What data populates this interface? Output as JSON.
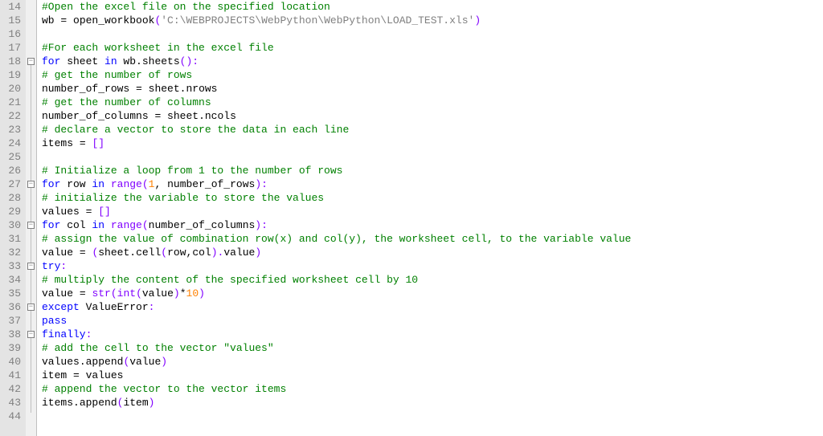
{
  "editor": {
    "first_line": 14,
    "last_line": 44,
    "fold_marks": [
      18,
      27,
      30,
      33,
      36,
      38
    ],
    "lines": [
      {
        "n": 14,
        "indent": 0,
        "tokens": [
          {
            "t": "#Open the excel file on the specified location",
            "c": "c-comment"
          }
        ]
      },
      {
        "n": 15,
        "indent": 0,
        "tokens": [
          {
            "t": "wb ",
            "c": "c-ident"
          },
          {
            "t": "=",
            "c": "c-op"
          },
          {
            "t": " open_workbook",
            "c": "c-ident"
          },
          {
            "t": "(",
            "c": "c-paren"
          },
          {
            "t": "'C:\\WEBPROJECTS\\WebPython\\WebPython\\LOAD_TEST.xls'",
            "c": "c-string"
          },
          {
            "t": ")",
            "c": "c-paren"
          }
        ]
      },
      {
        "n": 16,
        "indent": 0,
        "tokens": []
      },
      {
        "n": 17,
        "indent": 0,
        "tokens": [
          {
            "t": "#For each worksheet in the excel file",
            "c": "c-comment"
          }
        ]
      },
      {
        "n": 18,
        "indent": 0,
        "tokens": [
          {
            "t": "for",
            "c": "c-keyword"
          },
          {
            "t": " sheet ",
            "c": "c-ident"
          },
          {
            "t": "in",
            "c": "c-keyword"
          },
          {
            "t": " wb",
            "c": "c-ident"
          },
          {
            "t": ".",
            "c": "c-op"
          },
          {
            "t": "sheets",
            "c": "c-ident"
          },
          {
            "t": "():",
            "c": "c-paren"
          }
        ]
      },
      {
        "n": 19,
        "indent": 1,
        "tokens": [
          {
            "t": "# get the number of rows",
            "c": "c-comment"
          }
        ]
      },
      {
        "n": 20,
        "indent": 1,
        "tokens": [
          {
            "t": "number_of_rows ",
            "c": "c-ident"
          },
          {
            "t": "=",
            "c": "c-op"
          },
          {
            "t": " sheet",
            "c": "c-ident"
          },
          {
            "t": ".",
            "c": "c-op"
          },
          {
            "t": "nrows",
            "c": "c-ident"
          }
        ]
      },
      {
        "n": 21,
        "indent": 1,
        "tokens": [
          {
            "t": "# get the number of columns",
            "c": "c-comment"
          }
        ]
      },
      {
        "n": 22,
        "indent": 1,
        "tokens": [
          {
            "t": "number_of_columns ",
            "c": "c-ident"
          },
          {
            "t": "=",
            "c": "c-op"
          },
          {
            "t": " sheet",
            "c": "c-ident"
          },
          {
            "t": ".",
            "c": "c-op"
          },
          {
            "t": "ncols",
            "c": "c-ident"
          }
        ]
      },
      {
        "n": 23,
        "indent": 1,
        "tokens": [
          {
            "t": "# declare a vector to store the data in each line",
            "c": "c-comment"
          }
        ]
      },
      {
        "n": 24,
        "indent": 1,
        "tokens": [
          {
            "t": "items ",
            "c": "c-ident"
          },
          {
            "t": "=",
            "c": "c-op"
          },
          {
            "t": " ",
            "c": "c-ident"
          },
          {
            "t": "[]",
            "c": "c-paren"
          }
        ]
      },
      {
        "n": 25,
        "indent": 0,
        "tokens": []
      },
      {
        "n": 26,
        "indent": 1,
        "tokens": [
          {
            "t": "# Initialize a loop from 1 to the number of rows",
            "c": "c-comment"
          }
        ]
      },
      {
        "n": 27,
        "indent": 1,
        "tokens": [
          {
            "t": "for",
            "c": "c-keyword"
          },
          {
            "t": " row ",
            "c": "c-ident"
          },
          {
            "t": "in",
            "c": "c-keyword"
          },
          {
            "t": " ",
            "c": "c-ident"
          },
          {
            "t": "range",
            "c": "c-builtin"
          },
          {
            "t": "(",
            "c": "c-paren"
          },
          {
            "t": "1",
            "c": "c-num"
          },
          {
            "t": ",",
            "c": "c-op"
          },
          {
            "t": " number_of_rows",
            "c": "c-ident"
          },
          {
            "t": "):",
            "c": "c-paren"
          }
        ]
      },
      {
        "n": 28,
        "indent": 2,
        "tokens": [
          {
            "t": "# initialize the variable to store the values",
            "c": "c-comment"
          }
        ]
      },
      {
        "n": 29,
        "indent": 2,
        "tokens": [
          {
            "t": "values ",
            "c": "c-ident"
          },
          {
            "t": "=",
            "c": "c-op"
          },
          {
            "t": " ",
            "c": "c-ident"
          },
          {
            "t": "[]",
            "c": "c-paren"
          }
        ]
      },
      {
        "n": 30,
        "indent": 2,
        "tokens": [
          {
            "t": "for",
            "c": "c-keyword"
          },
          {
            "t": " col ",
            "c": "c-ident"
          },
          {
            "t": "in",
            "c": "c-keyword"
          },
          {
            "t": " ",
            "c": "c-ident"
          },
          {
            "t": "range",
            "c": "c-builtin"
          },
          {
            "t": "(",
            "c": "c-paren"
          },
          {
            "t": "number_of_columns",
            "c": "c-ident"
          },
          {
            "t": "):",
            "c": "c-paren"
          }
        ]
      },
      {
        "n": 31,
        "indent": 3,
        "tokens": [
          {
            "t": "# assign the value of combination row(x) and col(y), the worksheet cell, to the variable value",
            "c": "c-comment"
          }
        ]
      },
      {
        "n": 32,
        "indent": 3,
        "tokens": [
          {
            "t": "value  ",
            "c": "c-ident"
          },
          {
            "t": "=",
            "c": "c-op"
          },
          {
            "t": " ",
            "c": "c-ident"
          },
          {
            "t": "(",
            "c": "c-paren"
          },
          {
            "t": "sheet",
            "c": "c-ident"
          },
          {
            "t": ".",
            "c": "c-op"
          },
          {
            "t": "cell",
            "c": "c-ident"
          },
          {
            "t": "(",
            "c": "c-paren"
          },
          {
            "t": "row",
            "c": "c-ident"
          },
          {
            "t": ",",
            "c": "c-op"
          },
          {
            "t": "col",
            "c": "c-ident"
          },
          {
            "t": ").",
            "c": "c-paren"
          },
          {
            "t": "value",
            "c": "c-ident"
          },
          {
            "t": ")",
            "c": "c-paren"
          }
        ]
      },
      {
        "n": 33,
        "indent": 3,
        "tokens": [
          {
            "t": "try",
            "c": "c-keyword"
          },
          {
            "t": ":",
            "c": "c-paren"
          }
        ]
      },
      {
        "n": 34,
        "indent": 4,
        "tokens": [
          {
            "t": "# multiply the content of the specified worksheet cell by 10",
            "c": "c-comment"
          }
        ]
      },
      {
        "n": 35,
        "indent": 4,
        "tokens": [
          {
            "t": "value ",
            "c": "c-ident"
          },
          {
            "t": "=",
            "c": "c-op"
          },
          {
            "t": " ",
            "c": "c-ident"
          },
          {
            "t": "str",
            "c": "c-builtin"
          },
          {
            "t": "(",
            "c": "c-paren"
          },
          {
            "t": "int",
            "c": "c-builtin"
          },
          {
            "t": "(",
            "c": "c-paren"
          },
          {
            "t": "value",
            "c": "c-ident"
          },
          {
            "t": ")",
            "c": "c-paren"
          },
          {
            "t": "*",
            "c": "c-op"
          },
          {
            "t": "10",
            "c": "c-num"
          },
          {
            "t": ")",
            "c": "c-paren"
          }
        ]
      },
      {
        "n": 36,
        "indent": 3,
        "tokens": [
          {
            "t": "except",
            "c": "c-keyword"
          },
          {
            "t": " ValueError",
            "c": "c-except"
          },
          {
            "t": ":",
            "c": "c-paren"
          }
        ]
      },
      {
        "n": 37,
        "indent": 4,
        "tokens": [
          {
            "t": "pass",
            "c": "c-keyword"
          }
        ]
      },
      {
        "n": 38,
        "indent": 3,
        "tokens": [
          {
            "t": "finally",
            "c": "c-keyword"
          },
          {
            "t": ":",
            "c": "c-paren"
          }
        ]
      },
      {
        "n": 39,
        "indent": 4,
        "tokens": [
          {
            "t": "# add the cell to the vector \"values\"",
            "c": "c-comment"
          }
        ]
      },
      {
        "n": 40,
        "indent": 4,
        "tokens": [
          {
            "t": "values",
            "c": "c-ident"
          },
          {
            "t": ".",
            "c": "c-op"
          },
          {
            "t": "append",
            "c": "c-ident"
          },
          {
            "t": "(",
            "c": "c-paren"
          },
          {
            "t": "value",
            "c": "c-ident"
          },
          {
            "t": ")",
            "c": "c-paren"
          }
        ]
      },
      {
        "n": 41,
        "indent": 2,
        "tokens": [
          {
            "t": "item ",
            "c": "c-ident"
          },
          {
            "t": "=",
            "c": "c-op"
          },
          {
            "t": " values",
            "c": "c-ident"
          }
        ]
      },
      {
        "n": 42,
        "indent": 2,
        "tokens": [
          {
            "t": "# append the vector to the vector items",
            "c": "c-comment"
          }
        ]
      },
      {
        "n": 43,
        "indent": 2,
        "tokens": [
          {
            "t": "items",
            "c": "c-ident"
          },
          {
            "t": ".",
            "c": "c-op"
          },
          {
            "t": "append",
            "c": "c-ident"
          },
          {
            "t": "(",
            "c": "c-paren"
          },
          {
            "t": "item",
            "c": "c-ident"
          },
          {
            "t": ")",
            "c": "c-paren"
          }
        ]
      },
      {
        "n": 44,
        "indent": 0,
        "tokens": []
      }
    ]
  }
}
